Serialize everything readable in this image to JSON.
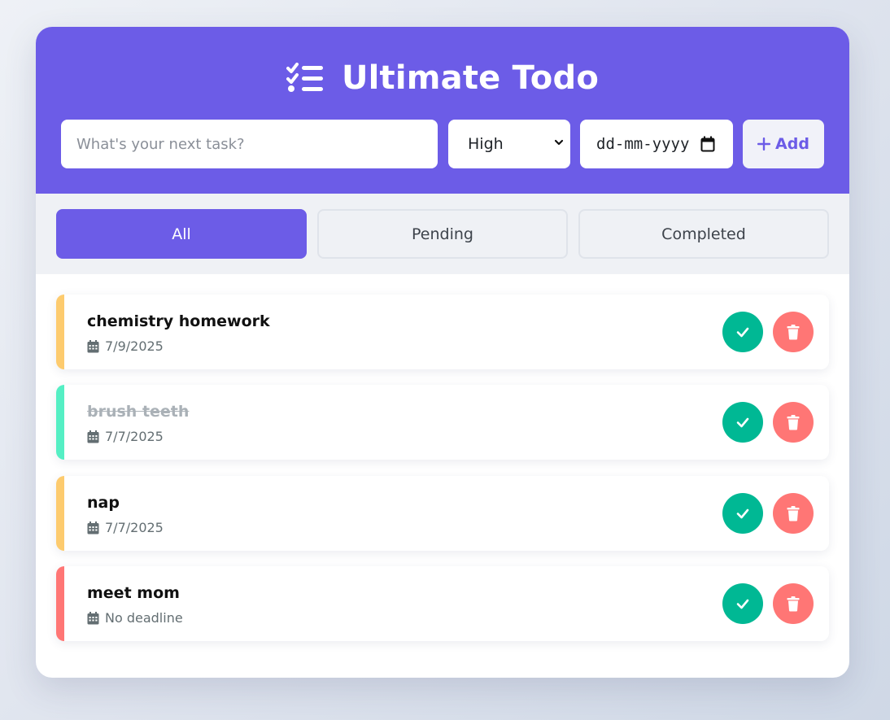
{
  "app": {
    "title": "Ultimate Todo",
    "icon": "list-check-icon",
    "accent": "#6c5ce7"
  },
  "form": {
    "task_placeholder": "What's your next task?",
    "task_value": "",
    "priority_selected": "High",
    "date_placeholder": "dd-mm-yyyy",
    "add_label": "Add"
  },
  "filters": [
    {
      "label": "All",
      "active": true
    },
    {
      "label": "Pending",
      "active": false
    },
    {
      "label": "Completed",
      "active": false
    }
  ],
  "todos": [
    {
      "text": "chemistry homework",
      "date": "7/9/2025",
      "completed": false,
      "priority_color": "#fdcb6e"
    },
    {
      "text": "brush teeth",
      "date": "7/7/2025",
      "completed": true,
      "priority_color": "#55efc4"
    },
    {
      "text": "nap",
      "date": "7/7/2025",
      "completed": false,
      "priority_color": "#fdcb6e"
    },
    {
      "text": "meet mom",
      "date": "No deadline",
      "completed": false,
      "priority_color": "#ff7675"
    }
  ],
  "colors": {
    "complete_button": "#00b894",
    "delete_button": "#ff7675"
  }
}
